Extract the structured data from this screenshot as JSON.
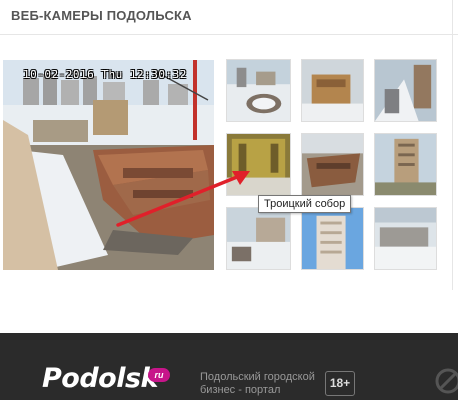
{
  "header": {
    "title": "ВЕБ-КАМЕРЫ ПОДОЛЬСКА"
  },
  "main_camera": {
    "timestamp": "10-02-2016 Thu 12:30:32"
  },
  "thumbnails": [
    {
      "icon": "webcam-snapshot"
    },
    {
      "icon": "webcam-snapshot"
    },
    {
      "icon": "webcam-snapshot"
    },
    {
      "icon": "webcam-snapshot"
    },
    {
      "icon": "webcam-snapshot"
    },
    {
      "icon": "webcam-snapshot"
    },
    {
      "icon": "webcam-snapshot"
    },
    {
      "icon": "webcam-snapshot"
    },
    {
      "icon": "webcam-snapshot"
    }
  ],
  "tooltip": {
    "text": "Троицкий собор"
  },
  "footer": {
    "logo_text": "Podolsk",
    "logo_suffix": "ru",
    "description": "Подольский городской бизнес - портал",
    "age_rating": "18+"
  },
  "colors": {
    "footer_bg": "#2b2b2b",
    "logo_badge": "#c7158a",
    "pointer_arrow": "#e0202a"
  }
}
